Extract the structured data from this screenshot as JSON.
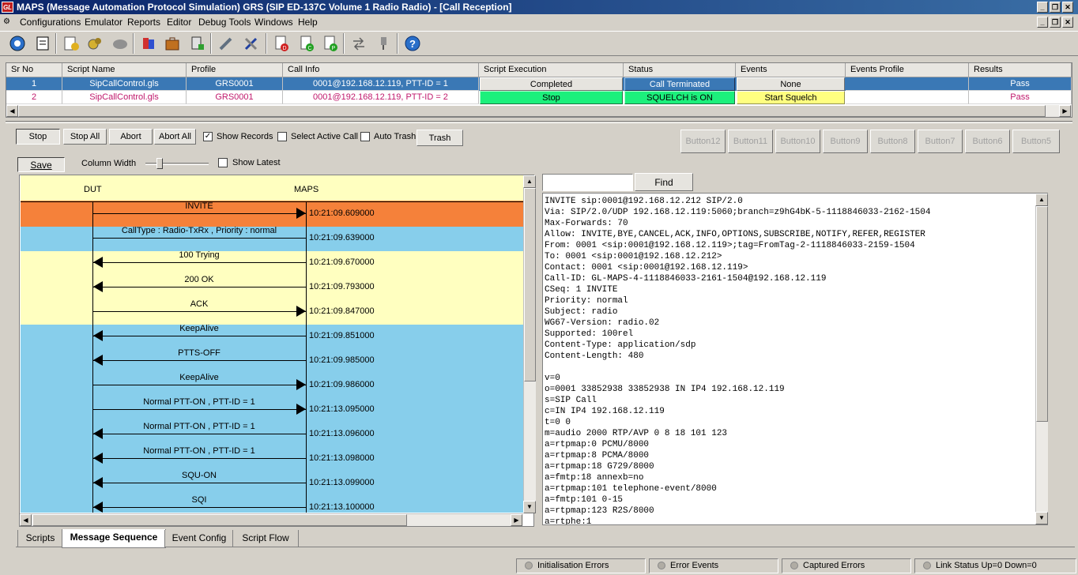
{
  "window": {
    "title": "MAPS (Message Automation Protocol Simulation) GRS (SIP ED-137C Volume 1 Radio Radio) - [Call Reception]"
  },
  "menu": [
    "Configurations",
    "Emulator",
    "Reports",
    "Editor",
    "Debug Tools",
    "Windows",
    "Help"
  ],
  "toolbar_icons": [
    "configuration-icon",
    "notebook-icon",
    "script-editor-icon",
    "gears-icon",
    "cloud-icon",
    "objects-icon",
    "briefcase-icon",
    "server-icon",
    "pen-icon",
    "tools-icon",
    "doc-d-icon",
    "doc-c-icon",
    "doc-p-icon",
    "transfer-icon",
    "probe-icon",
    "help-icon"
  ],
  "grid": {
    "headers": [
      "Sr No",
      "Script Name",
      "Profile",
      "Call Info",
      "Script Execution",
      "Status",
      "Events",
      "Events Profile",
      "Results"
    ],
    "rows": [
      {
        "srno": "1",
        "script": "SipCallControl.gls",
        "profile": "GRS0001",
        "callinfo": "0001@192.168.12.119, PTT-ID = 1",
        "exec": "Completed",
        "status": "Call Terminated",
        "events": "None",
        "evprofile": "",
        "result": "Pass"
      },
      {
        "srno": "2",
        "script": "SipCallControl.gls",
        "profile": "GRS0001",
        "callinfo": "0001@192.168.12.119, PTT-ID = 2",
        "exec": "Stop",
        "status": "SQUELCH is ON",
        "events": "Start Squelch",
        "evprofile": "",
        "result": "Pass"
      }
    ]
  },
  "controls": {
    "stop": "Stop",
    "stop_all": "Stop All",
    "abort": "Abort",
    "abort_all": "Abort All",
    "show_records": "Show Records",
    "select_active_call": "Select Active Call",
    "auto_trash": "Auto Trash",
    "trash": "Trash",
    "custom_buttons": [
      "Button12",
      "Button11",
      "Button10",
      "Button9",
      "Button8",
      "Button7",
      "Button6",
      "Button5"
    ],
    "save": "Save",
    "column_width": "Column Width",
    "show_latest": "Show Latest",
    "find": "Find",
    "find_value": ""
  },
  "ladder": {
    "left": "DUT",
    "right": "MAPS",
    "messages": [
      {
        "label": "INVITE",
        "dir": "right",
        "time": "10:21:09.609000"
      },
      {
        "label": "CallType : Radio-TxRx , Priority : normal",
        "dir": "none",
        "time": "10:21:09.639000"
      },
      {
        "label": "100  Trying",
        "dir": "left",
        "time": "10:21:09.670000"
      },
      {
        "label": "200  OK",
        "dir": "left",
        "time": "10:21:09.793000"
      },
      {
        "label": "ACK",
        "dir": "right",
        "time": "10:21:09.847000"
      },
      {
        "label": "KeepAlive",
        "dir": "left",
        "time": "10:21:09.851000"
      },
      {
        "label": "PTTS-OFF",
        "dir": "left",
        "time": "10:21:09.985000"
      },
      {
        "label": "KeepAlive",
        "dir": "right",
        "time": "10:21:09.986000"
      },
      {
        "label": "Normal PTT-ON , PTT-ID = 1",
        "dir": "right",
        "time": "10:21:13.095000"
      },
      {
        "label": "Normal PTT-ON , PTT-ID = 1",
        "dir": "left",
        "time": "10:21:13.096000"
      },
      {
        "label": "Normal PTT-ON , PTT-ID = 1",
        "dir": "left",
        "time": "10:21:13.098000"
      },
      {
        "label": "SQU-ON",
        "dir": "left",
        "time": "10:21:13.099000"
      },
      {
        "label": "SQI",
        "dir": "left",
        "time": "10:21:13.100000"
      }
    ]
  },
  "raw_message": [
    "INVITE sip:0001@192.168.12.212 SIP/2.0",
    "Via: SIP/2.0/UDP 192.168.12.119:5060;branch=z9hG4bK-5-1118846033-2162-1504",
    "Max-Forwards: 70",
    "Allow: INVITE,BYE,CANCEL,ACK,INFO,OPTIONS,SUBSCRIBE,NOTIFY,REFER,REGISTER",
    "From: 0001 <sip:0001@192.168.12.119>;tag=FromTag-2-1118846033-2159-1504",
    "To: 0001 <sip:0001@192.168.12.212>",
    "Contact: 0001 <sip:0001@192.168.12.119>",
    "Call-ID: GL-MAPS-4-1118846033-2161-1504@192.168.12.119",
    "CSeq: 1 INVITE",
    "Priority: normal",
    "Subject: radio",
    "WG67-Version: radio.02",
    "Supported: 100rel",
    "Content-Type: application/sdp",
    "Content-Length: 480",
    "",
    "v=0",
    "o=0001 33852938 33852938 IN IP4 192.168.12.119",
    "s=SIP Call",
    "c=IN IP4 192.168.12.119",
    "t=0 0",
    "m=audio 2000 RTP/AVP 0 8 18 101 123",
    "a=rtpmap:0 PCMU/8000",
    "a=rtpmap:8 PCMA/8000",
    "a=rtpmap:18 G729/8000",
    "a=fmtp:18 annexb=no",
    "a=rtpmap:101 telephone-event/8000",
    "a=fmtp:101 0-15",
    "a=rtpmap:123 R2S/8000",
    "a=rtphe:1"
  ],
  "tabs": [
    "Scripts",
    "Message Sequence",
    "Event Config",
    "Script Flow"
  ],
  "active_tab": "Message Sequence",
  "statusbar": [
    "Initialisation Errors",
    "Error Events",
    "Captured Errors",
    "Link Status Up=0 Down=0"
  ],
  "colors": {
    "orange": "#f5813a",
    "blue": "#87ceeb",
    "yellow": "#ffffc0",
    "green": "#1cf07c",
    "selected": "#3a78b5"
  }
}
